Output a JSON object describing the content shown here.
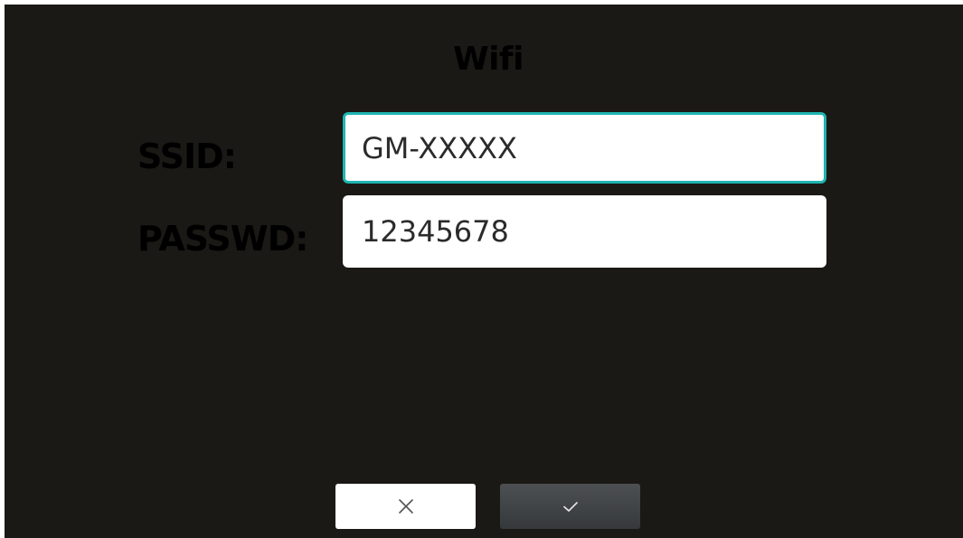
{
  "dialog": {
    "title": "Wifi"
  },
  "form": {
    "ssid": {
      "label": "SSID:",
      "value": "GM-XXXXX"
    },
    "password": {
      "label": "PASSWD:",
      "value": "12345678"
    }
  },
  "actions": {
    "cancel_icon": "close-icon",
    "confirm_icon": "check-icon"
  },
  "colors": {
    "background": "#1b1915",
    "focus_border": "#1fb5b0",
    "field_background": "#ffffff",
    "confirm_button": "#3f4244"
  }
}
